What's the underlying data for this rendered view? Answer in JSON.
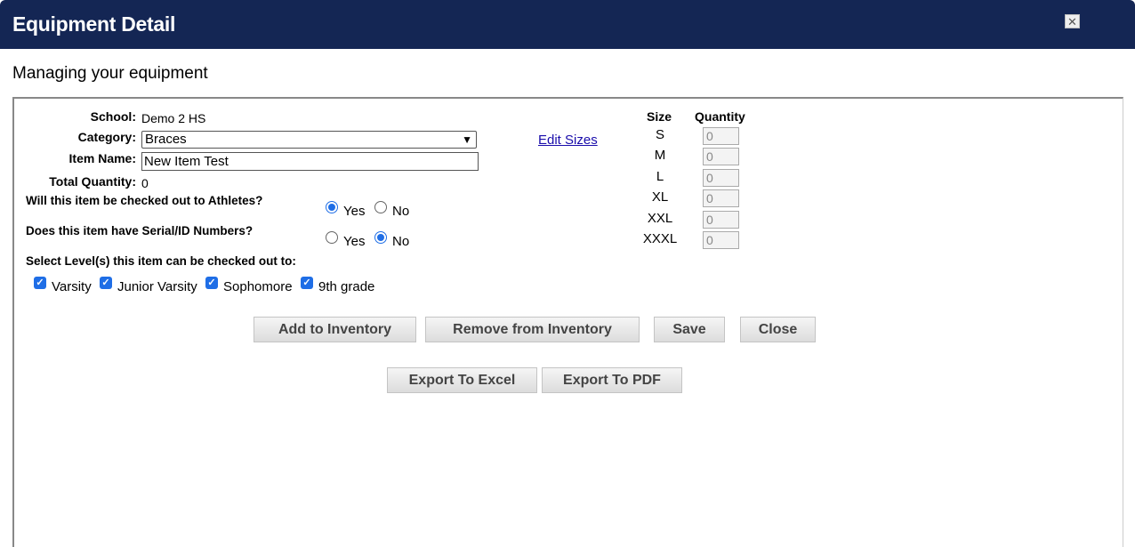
{
  "window": {
    "title": "Equipment Detail",
    "close_glyph": "✕"
  },
  "subtitle": "Managing your equipment",
  "form": {
    "school_label": "School:",
    "school_value": "Demo 2 HS",
    "category_label": "Category:",
    "category_value": "Braces",
    "item_name_label": "Item Name:",
    "item_name_value": "New Item Test",
    "total_qty_label": "Total Quantity:",
    "total_qty_value": "0",
    "checkout_question": "Will this item be checked out to Athletes?",
    "serial_question": "Does this item have Serial/ID Numbers?",
    "yes": "Yes",
    "no": "No",
    "checkout_selected": "Yes",
    "serial_selected": "No",
    "levels_label": "Select Level(s) this item can be checked out to:",
    "levels": [
      "Varsity",
      "Junior Varsity",
      "Sophomore",
      "9th grade"
    ],
    "edit_sizes": "Edit Sizes"
  },
  "sizes": {
    "size_header": "Size",
    "qty_header": "Quantity",
    "rows": [
      {
        "size": "S",
        "qty": "0"
      },
      {
        "size": "M",
        "qty": "0"
      },
      {
        "size": "L",
        "qty": "0"
      },
      {
        "size": "XL",
        "qty": "0"
      },
      {
        "size": "XXL",
        "qty": "0"
      },
      {
        "size": "XXXL",
        "qty": "0"
      }
    ]
  },
  "buttons": {
    "add": "Add to Inventory",
    "remove": "Remove from Inventory",
    "save": "Save",
    "close": "Close",
    "excel": "Export To Excel",
    "pdf": "Export To PDF"
  },
  "colors": {
    "titlebar": "#142654",
    "accent": "#1f6ee6",
    "link": "#1a0dab"
  }
}
